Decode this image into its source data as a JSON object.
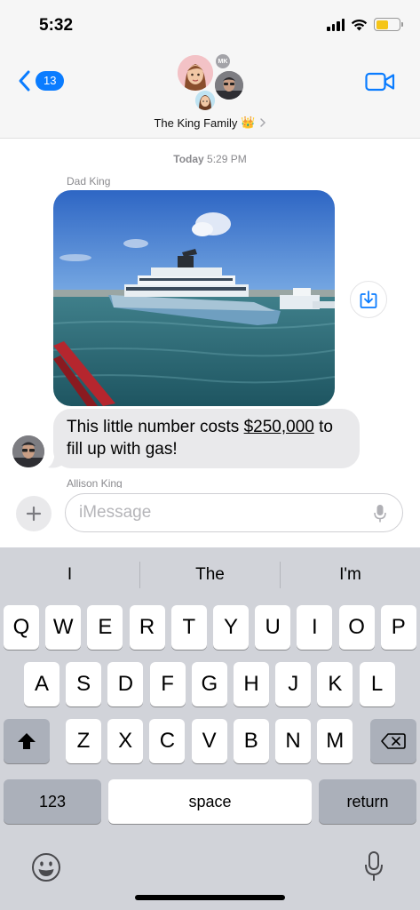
{
  "status_bar": {
    "time": "5:32",
    "battery_level": 0.55,
    "battery_color": "#f5c518"
  },
  "header": {
    "back_badge": "13",
    "group_name": "The King Family",
    "group_emoji": "👑",
    "member_initials": "MK",
    "accent_color": "#0a7cff",
    "icons": [
      "back-chevron-icon",
      "video-camera-icon",
      "chevron-right-icon"
    ]
  },
  "conversation": {
    "timestamp_day": "Today",
    "timestamp_time": "5:29 PM",
    "messages": [
      {
        "sender": "Dad King",
        "type": "photo"
      },
      {
        "type": "text",
        "text_before": "This little number costs ",
        "link_text": "$250,000",
        "text_after": " to fill up with gas!"
      }
    ],
    "next_sender": "Allison King"
  },
  "input": {
    "placeholder": "iMessage",
    "value": ""
  },
  "keyboard": {
    "suggestions": [
      "I",
      "The",
      "I'm"
    ],
    "row1": [
      "Q",
      "W",
      "E",
      "R",
      "T",
      "Y",
      "U",
      "I",
      "O",
      "P"
    ],
    "row2": [
      "A",
      "S",
      "D",
      "F",
      "G",
      "H",
      "J",
      "K",
      "L"
    ],
    "row3": [
      "Z",
      "X",
      "C",
      "V",
      "B",
      "N",
      "M"
    ],
    "numbers_label": "123",
    "space_label": "space",
    "return_label": "return"
  }
}
